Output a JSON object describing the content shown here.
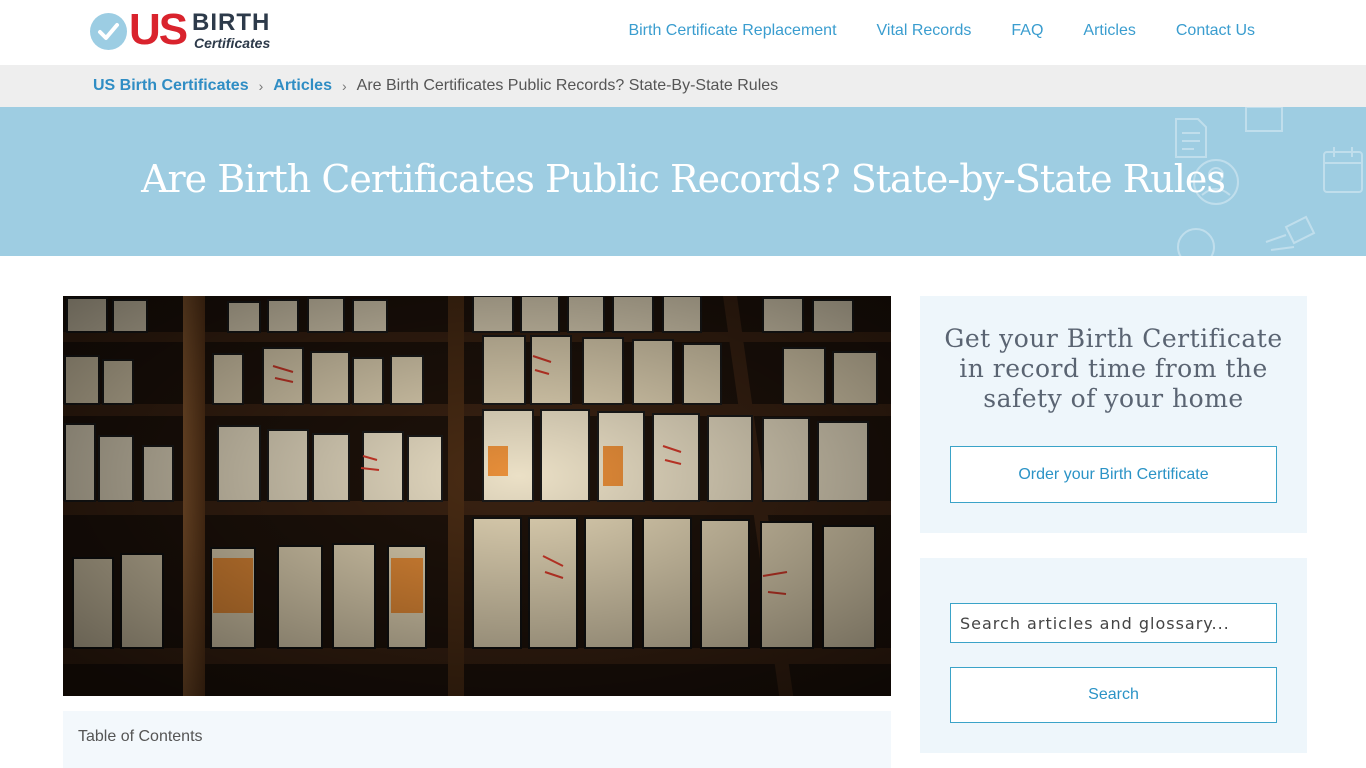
{
  "logo": {
    "us": "US",
    "birth": "BIRTH",
    "certificates": "Certificates",
    "colors": {
      "red": "#d9232d",
      "navy": "#2d3a4a",
      "check": "#9ccde3"
    }
  },
  "nav": {
    "items": [
      {
        "label": "Birth Certificate Replacement"
      },
      {
        "label": "Vital Records"
      },
      {
        "label": "FAQ"
      },
      {
        "label": "Articles"
      },
      {
        "label": "Contact Us"
      }
    ]
  },
  "breadcrumb": {
    "home": "US Birth Certificates",
    "section": "Articles",
    "current": "Are Birth Certificates Public Records? State-By-State Rules",
    "separator": "›"
  },
  "hero": {
    "title": "Are Birth Certificates Public Records? State-by-State Rules"
  },
  "toc": {
    "title": "Table of Contents"
  },
  "promo": {
    "text": "Get your Birth Certificate in record time from the safety of your home",
    "button_label": "Order your Birth Certificate"
  },
  "search": {
    "placeholder": "Search articles and glossary...",
    "button_label": "Search"
  },
  "colors": {
    "link": "#3a9dcf",
    "hero_bg": "#9ecde2",
    "breadcrumb_bg": "#eeeeee",
    "sidebar_bg": "#eef6fb",
    "button_border": "#3aa3c8"
  }
}
